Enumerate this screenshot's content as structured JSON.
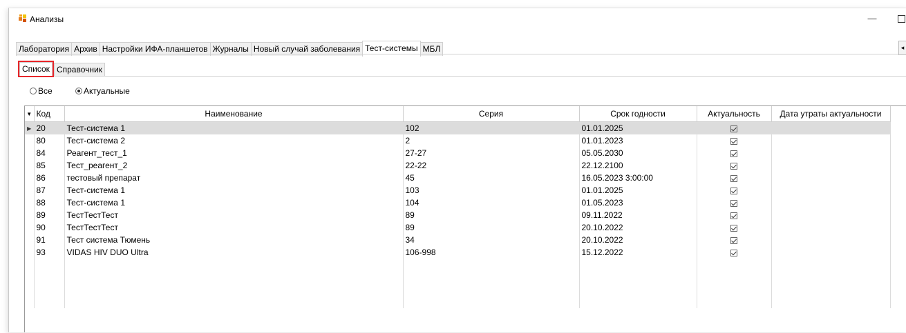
{
  "window": {
    "title": "Анализы",
    "minimize": "—"
  },
  "main_tabs": [
    "Лаборатория",
    "Архив",
    "Настройки ИФА-планшетов",
    "Журналы",
    "Новый случай заболевания",
    "Тест-системы",
    "МБЛ"
  ],
  "main_tabs_active": 5,
  "sub_tabs": [
    "Список",
    "Справочник"
  ],
  "sub_tabs_active": 0,
  "filter": {
    "all_label": "Все",
    "actual_label": "Актуальные",
    "selected": "actual"
  },
  "grid": {
    "columns": [
      "Код",
      "Наименование",
      "Серия",
      "Срок годности",
      "Актуальность",
      "Дата утраты актуальности"
    ],
    "rows": [
      {
        "code": "20",
        "name": "Тест-система 1",
        "series": "102",
        "expiry": "01.01.2025",
        "actual": true,
        "lost": ""
      },
      {
        "code": "80",
        "name": "Тест-система 2",
        "series": "2",
        "expiry": "01.01.2023",
        "actual": true,
        "lost": ""
      },
      {
        "code": "84",
        "name": "Реагент_тест_1",
        "series": "27-27",
        "expiry": "05.05.2030",
        "actual": true,
        "lost": ""
      },
      {
        "code": "85",
        "name": "Тест_реагент_2",
        "series": "22-22",
        "expiry": "22.12.2100",
        "actual": true,
        "lost": ""
      },
      {
        "code": "86",
        "name": "тестовый препарат",
        "series": "45",
        "expiry": "16.05.2023 3:00:00",
        "actual": true,
        "lost": ""
      },
      {
        "code": "87",
        "name": "Тест-система 1",
        "series": "103",
        "expiry": "01.01.2025",
        "actual": true,
        "lost": ""
      },
      {
        "code": "88",
        "name": "Тест-система 1",
        "series": "104",
        "expiry": "01.05.2023",
        "actual": true,
        "lost": ""
      },
      {
        "code": "89",
        "name": "ТестТестТест",
        "series": "89",
        "expiry": "09.11.2022",
        "actual": true,
        "lost": ""
      },
      {
        "code": "90",
        "name": "ТестТестТест",
        "series": "89",
        "expiry": "20.10.2022",
        "actual": true,
        "lost": ""
      },
      {
        "code": "91",
        "name": "Тест система Тюмень",
        "series": "34",
        "expiry": "20.10.2022",
        "actual": true,
        "lost": ""
      },
      {
        "code": "93",
        "name": "VIDAS HIV DUO Ultra",
        "series": "106-998",
        "expiry": "15.12.2022",
        "actual": true,
        "lost": ""
      }
    ],
    "selected_row": 0
  },
  "colors": {
    "highlight_border": "#e8262a",
    "selected_row_bg": "#dcdcdc"
  }
}
